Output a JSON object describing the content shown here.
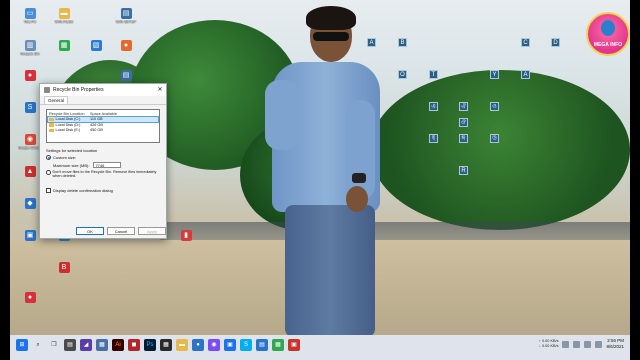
{
  "desktop": {
    "icons": [
      {
        "label": "This PC",
        "color": "#4a8fd6",
        "glyph": "▭"
      },
      {
        "label": "WIN-FILES",
        "color": "#e7b84a",
        "glyph": "▬"
      },
      {
        "label": "WIN-SETUP",
        "color": "#3a6ea5",
        "glyph": "▤"
      },
      {
        "label": "Recycle Bin",
        "color": "#6a8fb8",
        "glyph": "▥"
      },
      {
        "label": "",
        "color": "#2fa84f",
        "glyph": "▦"
      },
      {
        "label": "",
        "color": "#2d7ad1",
        "glyph": "▧"
      },
      {
        "label": "",
        "color": "#e26a2c",
        "glyph": "●"
      },
      {
        "label": "",
        "color": "#d6303a",
        "glyph": "●"
      },
      {
        "label": "",
        "color": "#3a6ea5",
        "glyph": "▤"
      },
      {
        "label": "",
        "color": "#2a73c8",
        "glyph": "S"
      },
      {
        "label": "Google Chrome",
        "color": "#d84a38",
        "glyph": "◉"
      },
      {
        "label": "",
        "color": "#cc2f2f",
        "glyph": "▲"
      },
      {
        "label": "",
        "color": "#2a73c8",
        "glyph": "◆"
      },
      {
        "label": "",
        "color": "#2a73c8",
        "glyph": "▣"
      },
      {
        "label": "",
        "color": "#2a8cd8",
        "glyph": "●"
      },
      {
        "label": "",
        "color": "#cc2f2f",
        "glyph": "B"
      },
      {
        "label": "",
        "color": "#d6303a",
        "glyph": "●"
      },
      {
        "label": "",
        "color": "#d83a3a",
        "glyph": "▮"
      }
    ],
    "tiles": [
      {
        "letter": "A"
      },
      {
        "letter": "B"
      },
      {
        "letter": "C"
      },
      {
        "letter": "D"
      },
      {
        "letter": "O"
      },
      {
        "letter": "T"
      },
      {
        "letter": "Y"
      },
      {
        "letter": "A"
      },
      {
        "letter": "এ"
      },
      {
        "letter": "ঐ"
      },
      {
        "letter": "ও"
      },
      {
        "letter": "ঔ"
      },
      {
        "letter": "ই"
      },
      {
        "letter": "ঈ"
      },
      {
        "letter": "উ"
      },
      {
        "letter": "R"
      }
    ],
    "logo": {
      "text": "MEGA INFO"
    }
  },
  "dialog": {
    "title": "Recycle Bin Properties",
    "close_icon": "close-icon",
    "tab": "General",
    "list": {
      "col_location": "Recycle Bin Location",
      "col_space": "Space Available",
      "rows": [
        {
          "location": "Local Disk (C:)",
          "space": "110 GB",
          "selected": true
        },
        {
          "location": "Local Disk (D:)",
          "space": "426 GB",
          "selected": false
        },
        {
          "location": "Local Disk (E:)",
          "space": "450 GB",
          "selected": false
        }
      ]
    },
    "settings_label": "Settings for selected location",
    "custom_size_label": "Custom size:",
    "max_size_label": "Maximum size (MB):",
    "max_size_value": "7746",
    "dont_move_label": "Don't move files to the Recycle Bin. Remove files immediately when deleted.",
    "display_confirm_label": "Display delete confirmation dialog",
    "ok_label": "OK",
    "cancel_label": "Cancel",
    "apply_label": "Apply"
  },
  "taskbar": {
    "icons": [
      {
        "name": "start-icon",
        "color": "#1a73e8",
        "glyph": "⊞"
      },
      {
        "name": "search-icon",
        "color": "#333333",
        "glyph": "⌕"
      },
      {
        "name": "task-view-icon",
        "color": "#333333",
        "glyph": "❐"
      },
      {
        "name": "app-icon",
        "color": "#4a4a4a",
        "glyph": "▤"
      },
      {
        "name": "app-icon",
        "color": "#5a3ea8",
        "glyph": "◢"
      },
      {
        "name": "app-icon",
        "color": "#4a6fa5",
        "glyph": "▦"
      },
      {
        "name": "illustrator-icon",
        "color": "#330000",
        "glyph": "Ai"
      },
      {
        "name": "app-icon",
        "color": "#b3262a",
        "glyph": "◼"
      },
      {
        "name": "photoshop-icon",
        "color": "#001e36",
        "glyph": "Ps"
      },
      {
        "name": "app-icon",
        "color": "#2a2a2a",
        "glyph": "▦"
      },
      {
        "name": "file-explorer-icon",
        "color": "#e6b94a",
        "glyph": "▬"
      },
      {
        "name": "app-icon",
        "color": "#2a73c8",
        "glyph": "●"
      },
      {
        "name": "messenger-icon",
        "color": "#7a4df0",
        "glyph": "◉"
      },
      {
        "name": "app-icon",
        "color": "#1a73e8",
        "glyph": "▣"
      },
      {
        "name": "skype-icon",
        "color": "#00aff0",
        "glyph": "S"
      },
      {
        "name": "app-icon",
        "color": "#2a73c8",
        "glyph": "▤"
      },
      {
        "name": "app-icon",
        "color": "#2fa84f",
        "glyph": "▦"
      },
      {
        "name": "app-icon",
        "color": "#c8342c",
        "glyph": "▣"
      }
    ],
    "net_up": "↑ 0.00 KB/s",
    "net_down": "↓ 0.00 KB/s",
    "time": "2:56 PM",
    "date": "8/6/2021"
  }
}
